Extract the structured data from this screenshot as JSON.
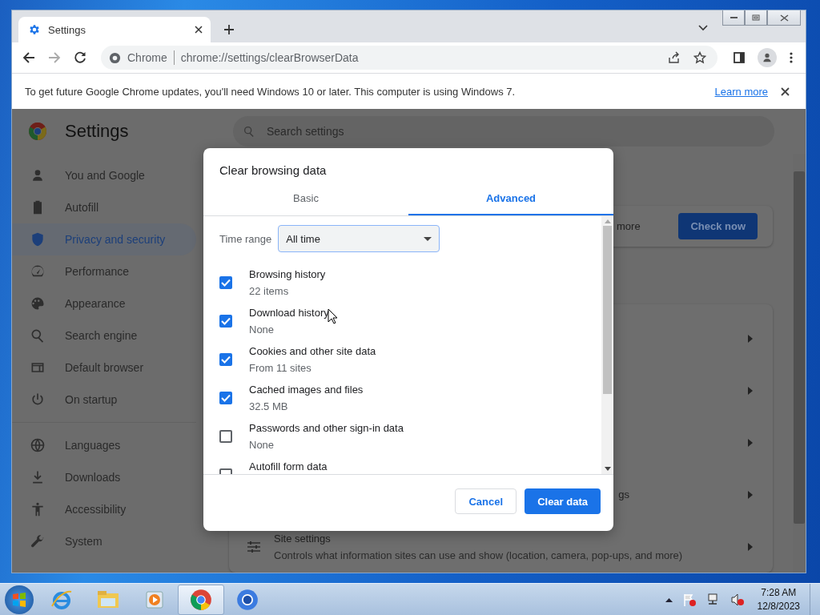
{
  "tabs": [
    {
      "title": "Settings",
      "selected": true
    }
  ],
  "address_bar": {
    "origin": "Chrome",
    "url": "chrome://settings/clearBrowserData"
  },
  "infobar": {
    "message": "To get future Google Chrome updates, you'll need Windows 10 or later. This computer is using Windows 7.",
    "link": "Learn more"
  },
  "settings": {
    "title": "Settings",
    "search_placeholder": "Search settings",
    "sidebar_groups": [
      [
        {
          "label": "You and Google",
          "selected": false
        },
        {
          "label": "Autofill",
          "selected": false
        },
        {
          "label": "Privacy and security",
          "selected": true
        },
        {
          "label": "Performance",
          "selected": false
        },
        {
          "label": "Appearance",
          "selected": false
        },
        {
          "label": "Search engine",
          "selected": false
        },
        {
          "label": "Default browser",
          "selected": false
        },
        {
          "label": "On startup",
          "selected": false
        }
      ],
      [
        {
          "label": "Languages",
          "selected": false
        },
        {
          "label": "Downloads",
          "selected": false
        },
        {
          "label": "Accessibility",
          "selected": false
        },
        {
          "label": "System",
          "selected": false
        }
      ]
    ],
    "safety_text": "more",
    "check_button": "Check now",
    "row_fragment": "gs",
    "site_settings": {
      "title": "Site settings",
      "description": "Controls what information sites can use and show (location, camera, pop-ups, and more)"
    }
  },
  "dialog": {
    "title": "Clear browsing data",
    "tabs": [
      {
        "label": "Basic",
        "selected": false
      },
      {
        "label": "Advanced",
        "selected": true
      }
    ],
    "time_range": {
      "label": "Time range",
      "value": "All time"
    },
    "items": [
      {
        "label": "Browsing history",
        "detail": "22 items",
        "checked": true
      },
      {
        "label": "Download history",
        "detail": "None",
        "checked": true
      },
      {
        "label": "Cookies and other site data",
        "detail": "From 11 sites",
        "checked": true
      },
      {
        "label": "Cached images and files",
        "detail": "32.5 MB",
        "checked": true
      },
      {
        "label": "Passwords and other sign-in data",
        "detail": "None",
        "checked": false
      },
      {
        "label": "Autofill form data",
        "checked": false
      }
    ],
    "cancel": "Cancel",
    "confirm": "Clear data"
  },
  "taskbar": {
    "apps": [
      {
        "selected": false
      },
      {
        "selected": false
      },
      {
        "selected": false
      },
      {
        "selected": true
      },
      {
        "selected": false
      }
    ],
    "time": "7:28 AM",
    "date": "12/8/2023"
  }
}
